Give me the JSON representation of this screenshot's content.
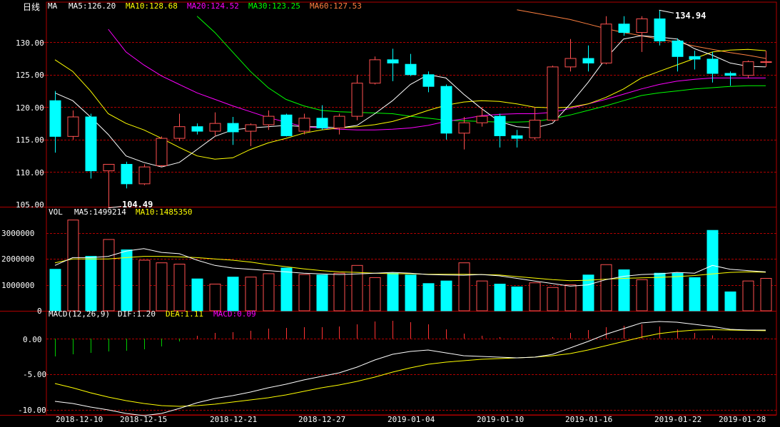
{
  "price_panel": {
    "title": "日线",
    "indicator": "MA",
    "ma_labels": [
      {
        "text": "MA5:126.20",
        "color": "#ffffff"
      },
      {
        "text": "MA10:128.68",
        "color": "#ffff00"
      },
      {
        "text": "MA20:124.52",
        "color": "#ff00ff"
      },
      {
        "text": "MA30:123.25",
        "color": "#00ff00"
      },
      {
        "text": "MA60:127.53",
        "color": "#ff8040"
      }
    ],
    "y_ticks": [
      "130.00",
      "125.00",
      "120.00",
      "115.00",
      "110.00",
      "105.00"
    ],
    "max_label": "134.94",
    "min_label": "104.49"
  },
  "volume_panel": {
    "title": "VOL",
    "ma_labels": [
      {
        "text": "MA5:1499214",
        "color": "#ffffff"
      },
      {
        "text": "MA10:1485350",
        "color": "#ffff00"
      }
    ],
    "y_ticks": [
      "3000000",
      "2000000",
      "1000000",
      "0"
    ]
  },
  "macd_panel": {
    "title": "MACD(12,26,9)",
    "labels": [
      {
        "text": "DIF:1.20",
        "color": "#ffffff"
      },
      {
        "text": "DEA:1.11",
        "color": "#ffff00"
      },
      {
        "text": "MACD:0.09",
        "color": "#ff00ff"
      }
    ],
    "y_ticks": [
      "0.00",
      "-5.00",
      "-10.00"
    ]
  },
  "x_labels": [
    "2018-12-10",
    "2018-12-15",
    "2018-12-21",
    "2018-12-27",
    "2019-01-04",
    "2019-01-10",
    "2019-01-16",
    "2019-01-22",
    "2019-01-28"
  ],
  "colors": {
    "up": "#ff5050",
    "down": "#00ffff",
    "grid": "#b00000",
    "axis": "#b00000",
    "tick_text": "#ffffff",
    "dif": "#ffffff",
    "dea": "#ffff00",
    "macd_pos": "#ff3333",
    "macd_neg": "#00cc00"
  },
  "chart_data": {
    "type": "candlestick",
    "price_range": [
      104,
      135
    ],
    "volume_range": [
      0,
      3600000
    ],
    "macd_range": [
      -10.5,
      2.5
    ],
    "candles": [
      {
        "o": 121.0,
        "h": 122.5,
        "l": 113.0,
        "c": 115.5,
        "v": 1600000
      },
      {
        "o": 115.5,
        "h": 119.5,
        "l": 115.0,
        "c": 118.5,
        "v": 3500000
      },
      {
        "o": 118.5,
        "h": 119.0,
        "l": 109.0,
        "c": 110.2,
        "v": 2100000
      },
      {
        "o": 110.2,
        "h": 111.2,
        "l": 104.49,
        "c": 111.2,
        "v": 2750000
      },
      {
        "o": 111.2,
        "h": 111.6,
        "l": 107.5,
        "c": 108.2,
        "v": 2350000
      },
      {
        "o": 108.2,
        "h": 111.2,
        "l": 108.0,
        "c": 110.8,
        "v": 1950000
      },
      {
        "o": 111.0,
        "h": 115.5,
        "l": 110.8,
        "c": 115.2,
        "v": 1850000
      },
      {
        "o": 115.2,
        "h": 119.0,
        "l": 114.8,
        "c": 117.0,
        "v": 1800000
      },
      {
        "o": 117.0,
        "h": 117.5,
        "l": 115.8,
        "c": 116.3,
        "v": 1230000
      },
      {
        "o": 116.3,
        "h": 119.2,
        "l": 115.5,
        "c": 117.5,
        "v": 1030000
      },
      {
        "o": 117.5,
        "h": 118.5,
        "l": 114.2,
        "c": 116.2,
        "v": 1300000
      },
      {
        "o": 116.3,
        "h": 117.5,
        "l": 114.0,
        "c": 117.3,
        "v": 1300000
      },
      {
        "o": 117.3,
        "h": 119.5,
        "l": 116.5,
        "c": 118.6,
        "v": 1430000
      },
      {
        "o": 118.8,
        "h": 119.0,
        "l": 115.5,
        "c": 115.6,
        "v": 1650000
      },
      {
        "o": 116.3,
        "h": 119.0,
        "l": 115.8,
        "c": 118.3,
        "v": 1400000
      },
      {
        "o": 118.3,
        "h": 120.3,
        "l": 116.5,
        "c": 116.8,
        "v": 1380000
      },
      {
        "o": 116.8,
        "h": 119.0,
        "l": 115.8,
        "c": 118.6,
        "v": 1450000
      },
      {
        "o": 118.6,
        "h": 125.0,
        "l": 118.0,
        "c": 123.7,
        "v": 1750000
      },
      {
        "o": 123.7,
        "h": 127.8,
        "l": 123.5,
        "c": 127.3,
        "v": 1280000
      },
      {
        "o": 127.3,
        "h": 129.0,
        "l": 124.0,
        "c": 126.8,
        "v": 1450000
      },
      {
        "o": 126.6,
        "h": 128.2,
        "l": 124.8,
        "c": 125.0,
        "v": 1380000
      },
      {
        "o": 125.0,
        "h": 125.5,
        "l": 122.3,
        "c": 123.2,
        "v": 1050000
      },
      {
        "o": 123.2,
        "h": 123.5,
        "l": 115.0,
        "c": 116.0,
        "v": 1150000
      },
      {
        "o": 116.0,
        "h": 118.5,
        "l": 113.5,
        "c": 117.6,
        "v": 1850000
      },
      {
        "o": 117.6,
        "h": 120.0,
        "l": 117.0,
        "c": 118.6,
        "v": 1150000
      },
      {
        "o": 118.6,
        "h": 119.0,
        "l": 113.8,
        "c": 115.6,
        "v": 1030000
      },
      {
        "o": 115.6,
        "h": 116.5,
        "l": 113.8,
        "c": 115.2,
        "v": 920000
      },
      {
        "o": 115.3,
        "h": 120.0,
        "l": 115.0,
        "c": 118.0,
        "v": 1080000
      },
      {
        "o": 118.0,
        "h": 126.4,
        "l": 117.8,
        "c": 126.2,
        "v": 900000
      },
      {
        "o": 126.2,
        "h": 130.5,
        "l": 125.5,
        "c": 127.5,
        "v": 1000000
      },
      {
        "o": 127.5,
        "h": 129.5,
        "l": 125.5,
        "c": 126.8,
        "v": 1380000
      },
      {
        "o": 126.8,
        "h": 134.0,
        "l": 126.6,
        "c": 132.8,
        "v": 1780000
      },
      {
        "o": 132.8,
        "h": 134.0,
        "l": 131.0,
        "c": 131.5,
        "v": 1580000
      },
      {
        "o": 131.5,
        "h": 134.0,
        "l": 128.5,
        "c": 133.6,
        "v": 1200000
      },
      {
        "o": 133.6,
        "h": 134.94,
        "l": 129.5,
        "c": 130.2,
        "v": 1450000
      },
      {
        "o": 130.2,
        "h": 130.6,
        "l": 125.5,
        "c": 127.8,
        "v": 1450000
      },
      {
        "o": 127.8,
        "h": 128.7,
        "l": 125.8,
        "c": 127.4,
        "v": 1280000
      },
      {
        "o": 127.4,
        "h": 128.5,
        "l": 123.8,
        "c": 125.2,
        "v": 3100000
      },
      {
        "o": 125.2,
        "h": 125.5,
        "l": 123.3,
        "c": 124.9,
        "v": 730000
      },
      {
        "o": 124.9,
        "h": 127.2,
        "l": 124.5,
        "c": 127.0,
        "v": 1150000
      },
      {
        "o": 127.0,
        "h": 128.7,
        "l": 126.2,
        "c": 127.0,
        "v": 1250000
      }
    ],
    "ma5": [
      122.2,
      121.0,
      118.5,
      115.8,
      112.5,
      111.5,
      110.8,
      111.5,
      113.5,
      115.5,
      116.5,
      116.8,
      117.0,
      117.2,
      117.0,
      117.0,
      116.8,
      117.2,
      119.0,
      121.0,
      123.5,
      125.0,
      124.5,
      122.0,
      119.8,
      117.8,
      117.0,
      116.8,
      117.5,
      120.5,
      123.8,
      127.5,
      130.5,
      131.0,
      130.8,
      130.5,
      129.0,
      128.0,
      126.8,
      126.3,
      126.2
    ],
    "ma10": [
      127.3,
      125.5,
      122.5,
      119.0,
      117.5,
      116.5,
      115.2,
      113.8,
      112.5,
      112.0,
      112.2,
      113.5,
      114.5,
      115.2,
      116.0,
      116.5,
      116.8,
      117.0,
      117.3,
      117.8,
      118.6,
      119.5,
      120.3,
      120.8,
      121.0,
      120.9,
      120.5,
      120.0,
      119.9,
      120.0,
      120.5,
      121.5,
      122.8,
      124.5,
      125.5,
      126.5,
      127.5,
      128.5,
      128.8,
      128.9,
      128.7
    ],
    "ma20": [
      null,
      null,
      null,
      132.0,
      128.5,
      126.5,
      124.8,
      123.5,
      122.2,
      121.2,
      120.2,
      119.3,
      118.4,
      117.7,
      117.0,
      116.8,
      116.6,
      116.5,
      116.5,
      116.6,
      116.8,
      117.2,
      117.8,
      118.2,
      118.7,
      118.9,
      119.0,
      119.0,
      119.2,
      119.8,
      120.5,
      121.2,
      122.0,
      122.8,
      123.5,
      124.0,
      124.3,
      124.5,
      124.5,
      124.5,
      124.5
    ],
    "ma30": [
      null,
      null,
      null,
      null,
      null,
      null,
      null,
      null,
      134.0,
      131.5,
      128.5,
      125.5,
      123.0,
      121.2,
      120.2,
      119.5,
      119.3,
      119.2,
      119.1,
      119.0,
      118.6,
      118.3,
      118.0,
      117.9,
      117.8,
      117.7,
      117.7,
      117.8,
      118.2,
      118.8,
      119.5,
      120.2,
      121.0,
      121.8,
      122.2,
      122.5,
      122.8,
      123.0,
      123.2,
      123.3,
      123.3
    ],
    "ma60": [
      null,
      null,
      null,
      null,
      null,
      null,
      null,
      null,
      null,
      null,
      null,
      null,
      null,
      null,
      null,
      null,
      null,
      null,
      null,
      null,
      null,
      null,
      null,
      null,
      null,
      null,
      135.0,
      134.5,
      134.0,
      133.5,
      132.8,
      132.1,
      131.5,
      131.0,
      130.5,
      130.0,
      129.4,
      128.9,
      128.4,
      128.0,
      127.5
    ],
    "vol_ma5": [
      1750000,
      2050000,
      2050000,
      2100000,
      2300000,
      2400000,
      2250000,
      2200000,
      1950000,
      1750000,
      1650000,
      1600000,
      1550000,
      1500000,
      1450000,
      1420000,
      1400000,
      1420000,
      1450000,
      1480000,
      1450000,
      1400000,
      1380000,
      1370000,
      1400000,
      1350000,
      1250000,
      1150000,
      1050000,
      950000,
      1000000,
      1200000,
      1330000,
      1400000,
      1420000,
      1480000,
      1450000,
      1750000,
      1600000,
      1550000,
      1499214
    ],
    "vol_ma10": [
      1850000,
      2000000,
      2000000,
      2000000,
      2050000,
      2100000,
      2100000,
      2080000,
      2050000,
      2000000,
      1950000,
      1880000,
      1780000,
      1700000,
      1620000,
      1550000,
      1500000,
      1480000,
      1450000,
      1430000,
      1430000,
      1410000,
      1410000,
      1410000,
      1400000,
      1380000,
      1320000,
      1260000,
      1200000,
      1160000,
      1180000,
      1220000,
      1250000,
      1270000,
      1290000,
      1320000,
      1360000,
      1420000,
      1480000,
      1500000,
      1485350
    ],
    "dif": [
      -8.8,
      -9.1,
      -9.6,
      -10.0,
      -10.5,
      -10.8,
      -10.5,
      -9.8,
      -9.0,
      -8.4,
      -8.0,
      -7.5,
      -6.9,
      -6.4,
      -5.8,
      -5.3,
      -4.8,
      -4.0,
      -3.0,
      -2.2,
      -1.8,
      -1.6,
      -2.0,
      -2.4,
      -2.5,
      -2.6,
      -2.7,
      -2.6,
      -2.2,
      -1.3,
      -0.4,
      0.6,
      1.4,
      2.2,
      2.4,
      2.3,
      2.0,
      1.7,
      1.3,
      1.2,
      1.2
    ],
    "dea": [
      -6.3,
      -6.9,
      -7.6,
      -8.2,
      -8.7,
      -9.1,
      -9.4,
      -9.5,
      -9.4,
      -9.2,
      -8.9,
      -8.6,
      -8.3,
      -7.9,
      -7.4,
      -6.9,
      -6.5,
      -6.0,
      -5.4,
      -4.7,
      -4.1,
      -3.6,
      -3.3,
      -3.1,
      -2.9,
      -2.8,
      -2.7,
      -2.6,
      -2.4,
      -2.1,
      -1.6,
      -1.0,
      -0.4,
      0.2,
      0.7,
      1.0,
      1.2,
      1.25,
      1.2,
      1.15,
      1.11
    ],
    "macd_bars": [
      -2.5,
      -2.2,
      -2.0,
      -1.8,
      -1.7,
      -1.5,
      -1.1,
      -0.4,
      0.4,
      0.8,
      0.9,
      1.1,
      1.4,
      1.5,
      1.6,
      1.6,
      1.7,
      2.0,
      2.4,
      2.5,
      2.3,
      2.0,
      1.3,
      0.7,
      0.4,
      0.2,
      0.0,
      0.0,
      0.2,
      0.8,
      1.2,
      1.6,
      1.8,
      2.0,
      1.7,
      1.3,
      0.8,
      0.45,
      0.1,
      0.05,
      0.09
    ]
  }
}
